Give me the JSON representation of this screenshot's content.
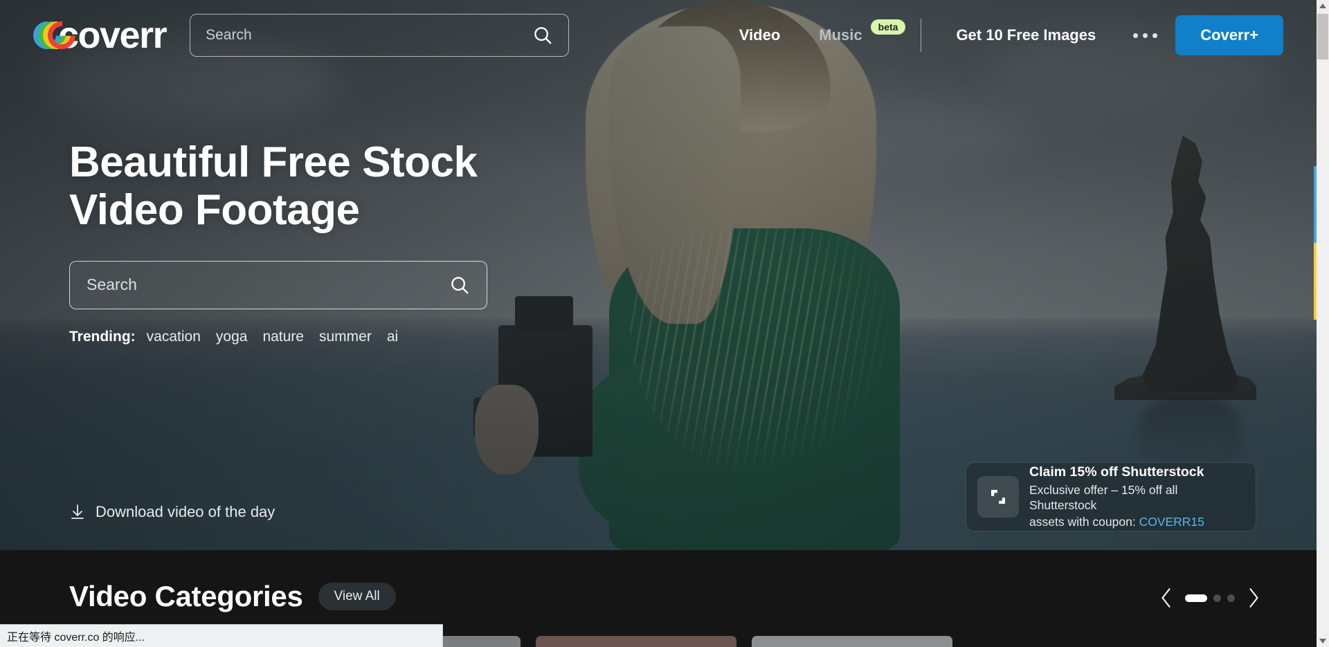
{
  "brand": {
    "name": "coverr",
    "accent": "#0f80c9"
  },
  "header": {
    "search": {
      "placeholder": "Search",
      "value": ""
    },
    "nav": [
      {
        "label": "Video",
        "active": true
      },
      {
        "label": "Music",
        "badge": "beta",
        "active": false
      },
      {
        "label": "Get 10 Free Images",
        "active": false
      }
    ],
    "more_label": "more-options",
    "cta_label": "Coverr+"
  },
  "hero": {
    "title_line1": "Beautiful Free Stock",
    "title_line2": "Video Footage",
    "search": {
      "placeholder": "Search",
      "value": ""
    },
    "trending_label": "Trending:",
    "trending": [
      "vacation",
      "yoga",
      "nature",
      "summer",
      "ai"
    ],
    "download_label": "Download video of the day"
  },
  "promo": {
    "title": "Claim 15% off Shutterstock",
    "line1": "Exclusive offer – 15% off all Shutterstock",
    "line2_prefix": "assets with coupon: ",
    "coupon": "COVERR15",
    "coupon_color": "#57b8ee"
  },
  "categories": {
    "title": "Video Categories",
    "view_all_label": "View All",
    "carousel": {
      "page": 1,
      "pages": 3
    },
    "thumbnails": [
      {
        "color": "#3a3326"
      },
      {
        "color": "#7b7d7e"
      },
      {
        "color": "#6a5450"
      },
      {
        "color": "#8d9093"
      }
    ]
  },
  "side_tab": {
    "top_color": "#3fa9e8",
    "bottom_color": "#ffcf33"
  },
  "status_bar": {
    "text": "正在等待 coverr.co 的响应..."
  }
}
